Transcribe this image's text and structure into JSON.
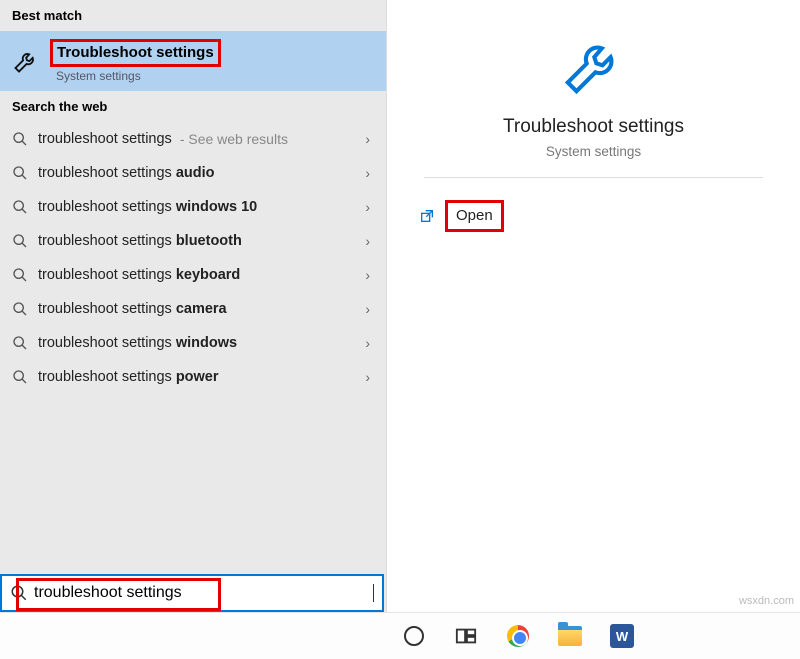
{
  "left": {
    "best_match_header": "Best match",
    "best_match": {
      "title": "Troubleshoot settings",
      "subtitle": "System settings"
    },
    "search_web_header": "Search the web",
    "web_items": [
      {
        "prefix": "troubleshoot settings",
        "bold": "",
        "hint": "- See web results"
      },
      {
        "prefix": "troubleshoot settings",
        "bold": "audio",
        "hint": ""
      },
      {
        "prefix": "troubleshoot settings",
        "bold": "windows 10",
        "hint": ""
      },
      {
        "prefix": "troubleshoot settings",
        "bold": "bluetooth",
        "hint": ""
      },
      {
        "prefix": "troubleshoot settings",
        "bold": "keyboard",
        "hint": ""
      },
      {
        "prefix": "troubleshoot settings",
        "bold": "camera",
        "hint": ""
      },
      {
        "prefix": "troubleshoot settings",
        "bold": "windows",
        "hint": ""
      },
      {
        "prefix": "troubleshoot settings",
        "bold": "power",
        "hint": ""
      }
    ]
  },
  "right": {
    "title": "Troubleshoot settings",
    "subtitle": "System settings",
    "open_label": "Open"
  },
  "search": {
    "value": "troubleshoot settings"
  },
  "watermark": "wsxdn.com"
}
